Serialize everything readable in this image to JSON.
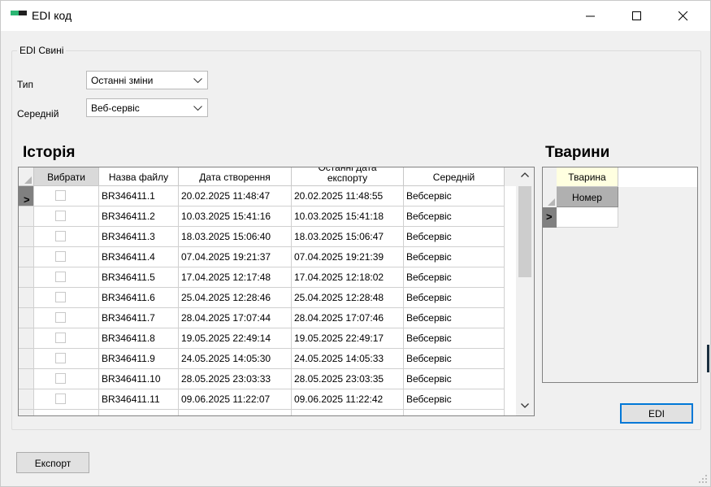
{
  "window": {
    "title": "EDI код",
    "icon": "app-green-black-icon"
  },
  "group": {
    "legend": "EDI Свині",
    "type_label": "Тип",
    "type_value": "Останні зміни",
    "medium_label": "Середній",
    "medium_value": "Веб-сервіс"
  },
  "history": {
    "title": "Історія",
    "columns": [
      "Вибрати",
      "Назва файлу",
      "Дата створення",
      "Останні дата експорту",
      "Середній"
    ],
    "current_row_index": 0,
    "rows": [
      {
        "selected": false,
        "file": "BR346411.1",
        "created": "20.02.2025 11:48:47",
        "exported": "20.02.2025 11:48:55",
        "medium": "Вебсервіс"
      },
      {
        "selected": false,
        "file": "BR346411.2",
        "created": "10.03.2025 15:41:16",
        "exported": "10.03.2025 15:41:18",
        "medium": "Вебсервіс"
      },
      {
        "selected": false,
        "file": "BR346411.3",
        "created": "18.03.2025 15:06:40",
        "exported": "18.03.2025 15:06:47",
        "medium": "Вебсервіс"
      },
      {
        "selected": false,
        "file": "BR346411.4",
        "created": "07.04.2025 19:21:37",
        "exported": "07.04.2025 19:21:39",
        "medium": "Вебсервіс"
      },
      {
        "selected": false,
        "file": "BR346411.5",
        "created": "17.04.2025 12:17:48",
        "exported": "17.04.2025 12:18:02",
        "medium": "Вебсервіс"
      },
      {
        "selected": false,
        "file": "BR346411.6",
        "created": "25.04.2025 12:28:46",
        "exported": "25.04.2025 12:28:48",
        "medium": "Вебсервіс"
      },
      {
        "selected": false,
        "file": "BR346411.7",
        "created": "28.04.2025 17:07:44",
        "exported": "28.04.2025 17:07:46",
        "medium": "Вебсервіс"
      },
      {
        "selected": false,
        "file": "BR346411.8",
        "created": "19.05.2025 22:49:14",
        "exported": "19.05.2025 22:49:17",
        "medium": "Вебсервіс"
      },
      {
        "selected": false,
        "file": "BR346411.9",
        "created": "24.05.2025 14:05:30",
        "exported": "24.05.2025 14:05:33",
        "medium": "Вебсервіс"
      },
      {
        "selected": false,
        "file": "BR346411.10",
        "created": "28.05.2025 23:03:33",
        "exported": "28.05.2025 23:03:35",
        "medium": "Вебсервіс"
      },
      {
        "selected": false,
        "file": "BR346411.11",
        "created": "09.06.2025 11:22:07",
        "exported": "09.06.2025 11:22:42",
        "medium": "Вебсервіс"
      }
    ]
  },
  "animals": {
    "title": "Тварини",
    "header": "Тварина",
    "subheader": "Номер"
  },
  "buttons": {
    "edi": "EDI",
    "export": "Експорт"
  }
}
